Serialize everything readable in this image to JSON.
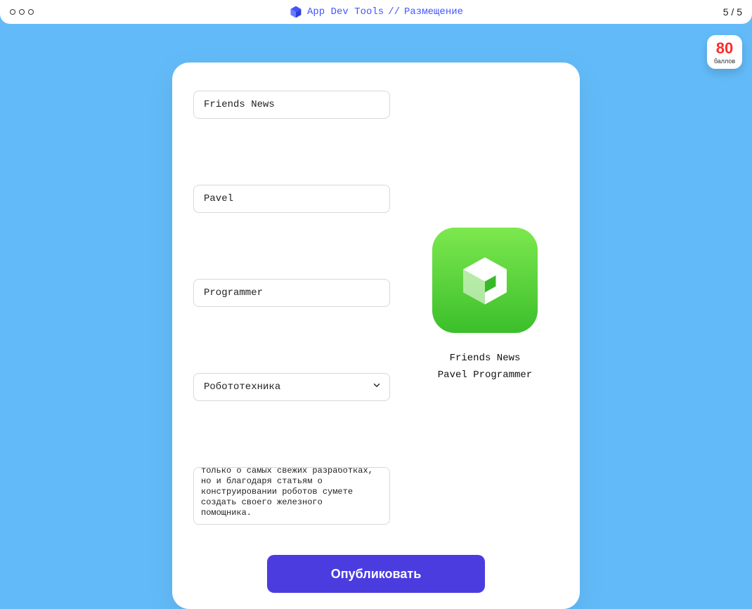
{
  "header": {
    "title_a": "App Dev Tools",
    "title_sep": "//",
    "title_b": "Размещение",
    "step": "5 / 5"
  },
  "score": {
    "value": "80",
    "label": "баллов"
  },
  "form": {
    "app_name": "Friends News",
    "first_name": "Pavel",
    "last_name": "Programmer",
    "category": "Робототехника",
    "description": "робототехники. Здесь вы узнаете не только о самых свежих разработках, но и благодаря статьям о конструировании роботов сумете создать своего железного помощника."
  },
  "preview": {
    "name": "Friends News",
    "author": "Pavel Programmer"
  },
  "actions": {
    "publish": "Опубликовать"
  }
}
